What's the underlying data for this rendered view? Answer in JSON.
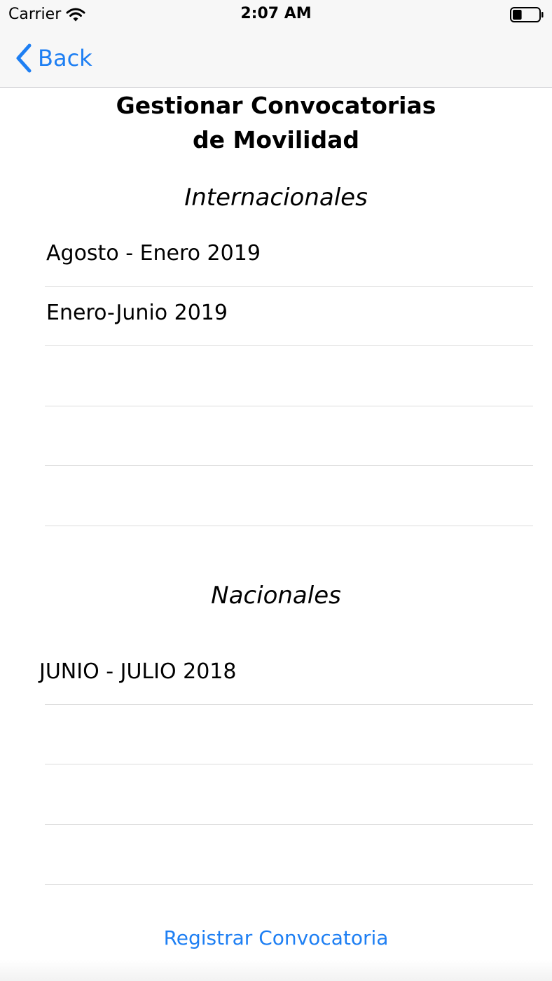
{
  "status_bar": {
    "carrier": "Carrier",
    "time": "2:07 AM",
    "wifi_icon": "wifi-icon",
    "battery_icon": "battery-icon",
    "battery_level_fraction": 0.35
  },
  "nav": {
    "back_label": "Back",
    "back_icon": "chevron-left-icon",
    "accent_color": "#1e7ff3"
  },
  "page": {
    "title_line1": "Gestionar Convocatorias",
    "title_line2": "de Movilidad"
  },
  "internacionales": {
    "title": "Internacionales",
    "rows": [
      "Agosto - Enero 2019",
      "Enero-Junio 2019",
      "",
      "",
      ""
    ]
  },
  "nacionales": {
    "title": "Nacionales",
    "rows": [
      "JUNIO - JULIO 2018",
      "",
      "",
      ""
    ]
  },
  "footer": {
    "register_label": "Registrar Convocatoria"
  }
}
